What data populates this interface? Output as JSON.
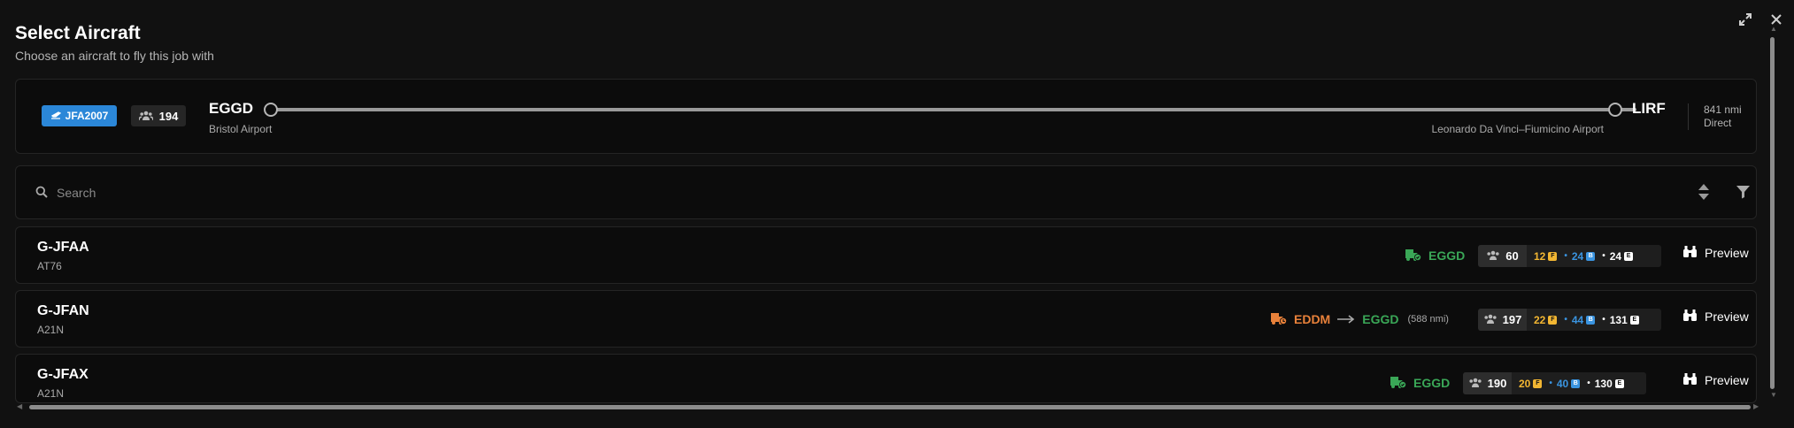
{
  "header": {
    "title": "Select Aircraft",
    "subtitle": "Choose an aircraft to fly this job with"
  },
  "window": {
    "expand_icon": "expand-icon",
    "close_icon": "close-icon"
  },
  "job": {
    "code": "JFA2007",
    "passengers": "194",
    "departure": {
      "code": "EGGD",
      "name": "Bristol Airport"
    },
    "arrival": {
      "code": "LIRF",
      "name": "Leonardo Da Vinci–Fiumicino Airport"
    },
    "distance": "841 nmi",
    "route_type": "Direct"
  },
  "search": {
    "placeholder": "Search"
  },
  "aircraft": [
    {
      "registration": "G-JFAA",
      "type": "AT76",
      "location": "EGGD",
      "from": "",
      "to": "",
      "ferry_distance": "",
      "total": "60",
      "first": "12",
      "business": "24",
      "economy": "24",
      "preview_label": "Preview"
    },
    {
      "registration": "G-JFAN",
      "type": "A21N",
      "location": "",
      "from": "EDDM",
      "to": "EGGD",
      "ferry_distance": "(588 nmi)",
      "total": "197",
      "first": "22",
      "business": "44",
      "economy": "131",
      "preview_label": "Preview"
    },
    {
      "registration": "G-JFAX",
      "type": "A21N",
      "location": "EGGD",
      "from": "",
      "to": "",
      "ferry_distance": "",
      "total": "190",
      "first": "20",
      "business": "40",
      "economy": "130",
      "preview_label": "Preview"
    }
  ],
  "class_tags": {
    "first": "F",
    "business": "B",
    "economy": "E"
  },
  "colors": {
    "accent_blue": "#2b87d8",
    "at_location_green": "#3aa757",
    "ferry_orange": "#e8813a",
    "first_class": "#f2b632",
    "business_class": "#3a94e0",
    "economy_class": "#ffffff"
  }
}
